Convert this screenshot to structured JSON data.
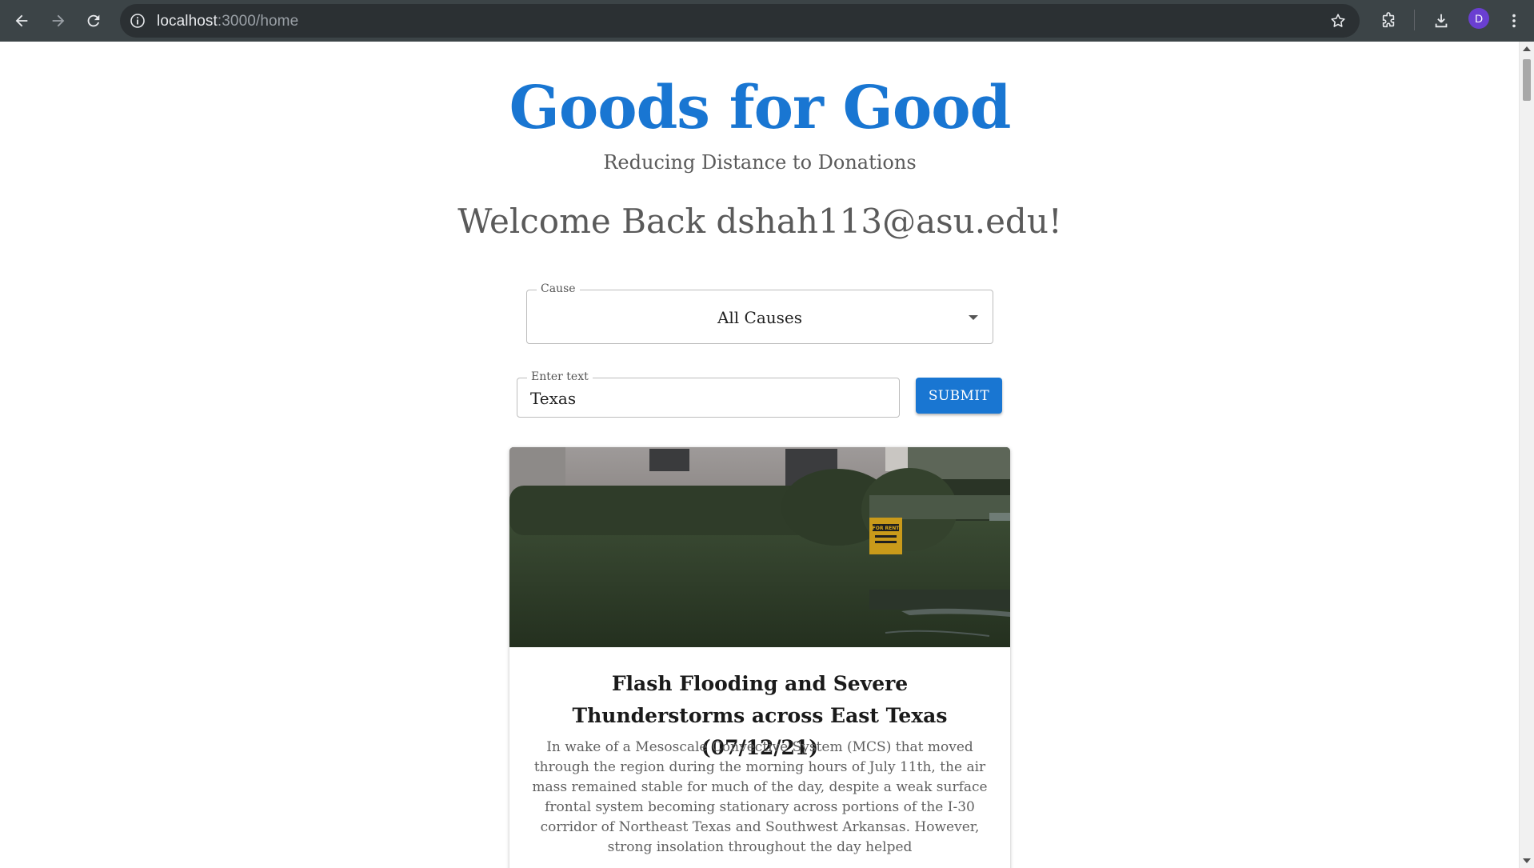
{
  "browser": {
    "url_host": "localhost",
    "url_path": ":3000/home",
    "avatar_letter": "D"
  },
  "header": {
    "title": "Goods for Good",
    "tagline": "Reducing Distance to Donations",
    "welcome": "Welcome Back dshah113@asu.edu!"
  },
  "filter": {
    "cause_label": "Cause",
    "cause_value": "All Causes",
    "text_label": "Enter text",
    "text_value": "Texas",
    "submit_label": "SUBMIT"
  },
  "cards": [
    {
      "title": "Flash Flooding and Severe Thunderstorms across East Texas (07/12/21)",
      "description": "In wake of a Mesoscale Convective System (MCS) that moved through the region during the morning hours of July 11th, the air mass remained stable for much of the day, despite a weak surface frontal system becoming stationary across portions of the I-30 corridor of Northeast Texas and Southwest Arkansas. However, strong insolation throughout the day helped",
      "sign_text": "FOR RENT"
    }
  ],
  "colors": {
    "brand": "#1976d2",
    "chrome_bg": "#3c4447",
    "text_muted": "#5a5a5a"
  }
}
